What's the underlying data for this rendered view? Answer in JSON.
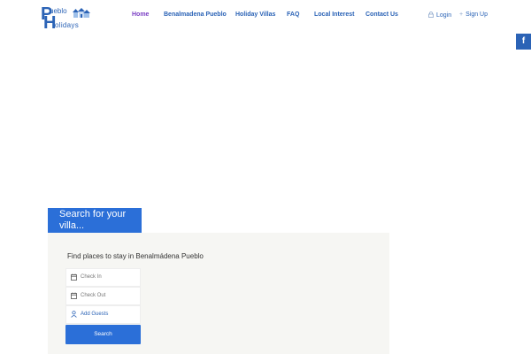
{
  "logo": {
    "letter_p": "P",
    "letter_h": "H",
    "word_top": "ueblo",
    "word_bottom": "olidays"
  },
  "nav": {
    "items": [
      {
        "label": "Home",
        "active": true
      },
      {
        "label": "Benalmadena Pueblo",
        "active": false
      },
      {
        "label": "Holiday Villas",
        "active": false
      },
      {
        "label": "FAQ",
        "active": false
      },
      {
        "label": "Local Interest",
        "active": false
      },
      {
        "label": "Contact Us",
        "active": false
      }
    ]
  },
  "account": {
    "login_label": "Login",
    "signup_label": "Sign Up",
    "login_icon": "lock-icon",
    "signup_icon": "plus-icon"
  },
  "social": {
    "facebook_glyph": "f",
    "facebook_icon": "facebook-icon"
  },
  "search": {
    "tab_title": "Search for your villa...",
    "panel_title": "Find places to stay in Benalmádena Pueblo",
    "check_in_placeholder": "Check In",
    "check_out_placeholder": "Check Out",
    "guests_label": "Add Guests",
    "search_button": "Search"
  },
  "colors": {
    "brand_blue": "#2b63b6",
    "button_blue": "#2b6fd8",
    "nav_active": "#7b3fc4",
    "panel_bg": "#f6f6f3"
  }
}
